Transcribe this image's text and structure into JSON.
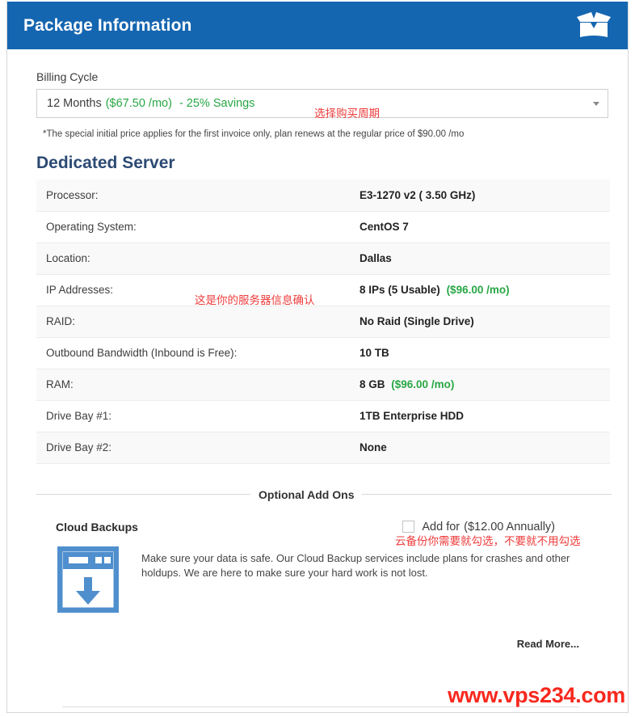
{
  "header": {
    "title": "Package Information",
    "icon": "open-box-icon"
  },
  "billing": {
    "label": "Billing Cycle",
    "selected_term": "12 Months",
    "selected_price": "($67.50 /mo)",
    "selected_savings": "-  25% Savings",
    "disclaimer": "*The special initial price applies for the first invoice only, plan renews at the regular price of $90.00 /mo"
  },
  "section": {
    "title": "Dedicated Server",
    "rows": [
      {
        "key": "Processor:",
        "value": "E3-1270 v2 ( 3.50 GHz)",
        "extra": ""
      },
      {
        "key": "Operating System:",
        "value": "CentOS 7",
        "extra": ""
      },
      {
        "key": "Location:",
        "value": "Dallas",
        "extra": ""
      },
      {
        "key": "IP Addresses:",
        "value": "8 IPs (5 Usable)",
        "extra": "($96.00 /mo)"
      },
      {
        "key": "RAID:",
        "value": "No Raid (Single Drive)",
        "extra": ""
      },
      {
        "key": "Outbound Bandwidth (Inbound is Free):",
        "value": "10 TB",
        "extra": ""
      },
      {
        "key": "RAM:",
        "value": "8 GB",
        "extra": "($96.00 /mo)"
      },
      {
        "key": "Drive Bay #1:",
        "value": "1TB Enterprise HDD",
        "extra": ""
      },
      {
        "key": "Drive Bay #2:",
        "value": "None",
        "extra": ""
      }
    ]
  },
  "addons": {
    "divider_label": "Optional Add Ons",
    "name": "Cloud Backups",
    "check_label": "Add for",
    "check_price": "($12.00 Annually)",
    "checked": false,
    "icon": "download-window-icon",
    "description": "Make sure your data is safe. Our Cloud Backup services include plans for crashes and other holdups. We are here to make sure your hard work is not lost.",
    "read_more": "Read More..."
  },
  "annotations": {
    "billing": "选择购买周期",
    "server": "这是你的服务器信息确认",
    "backup": "云备份你需要就勾选，不要就不用勾选"
  },
  "watermark": "www.vps234.com",
  "colors": {
    "header_blue": "#1566b0",
    "heading_navy": "#2c4a73",
    "price_green": "#28a745",
    "annotation_red": "#ee3b3b",
    "watermark_red": "#f8281e"
  }
}
